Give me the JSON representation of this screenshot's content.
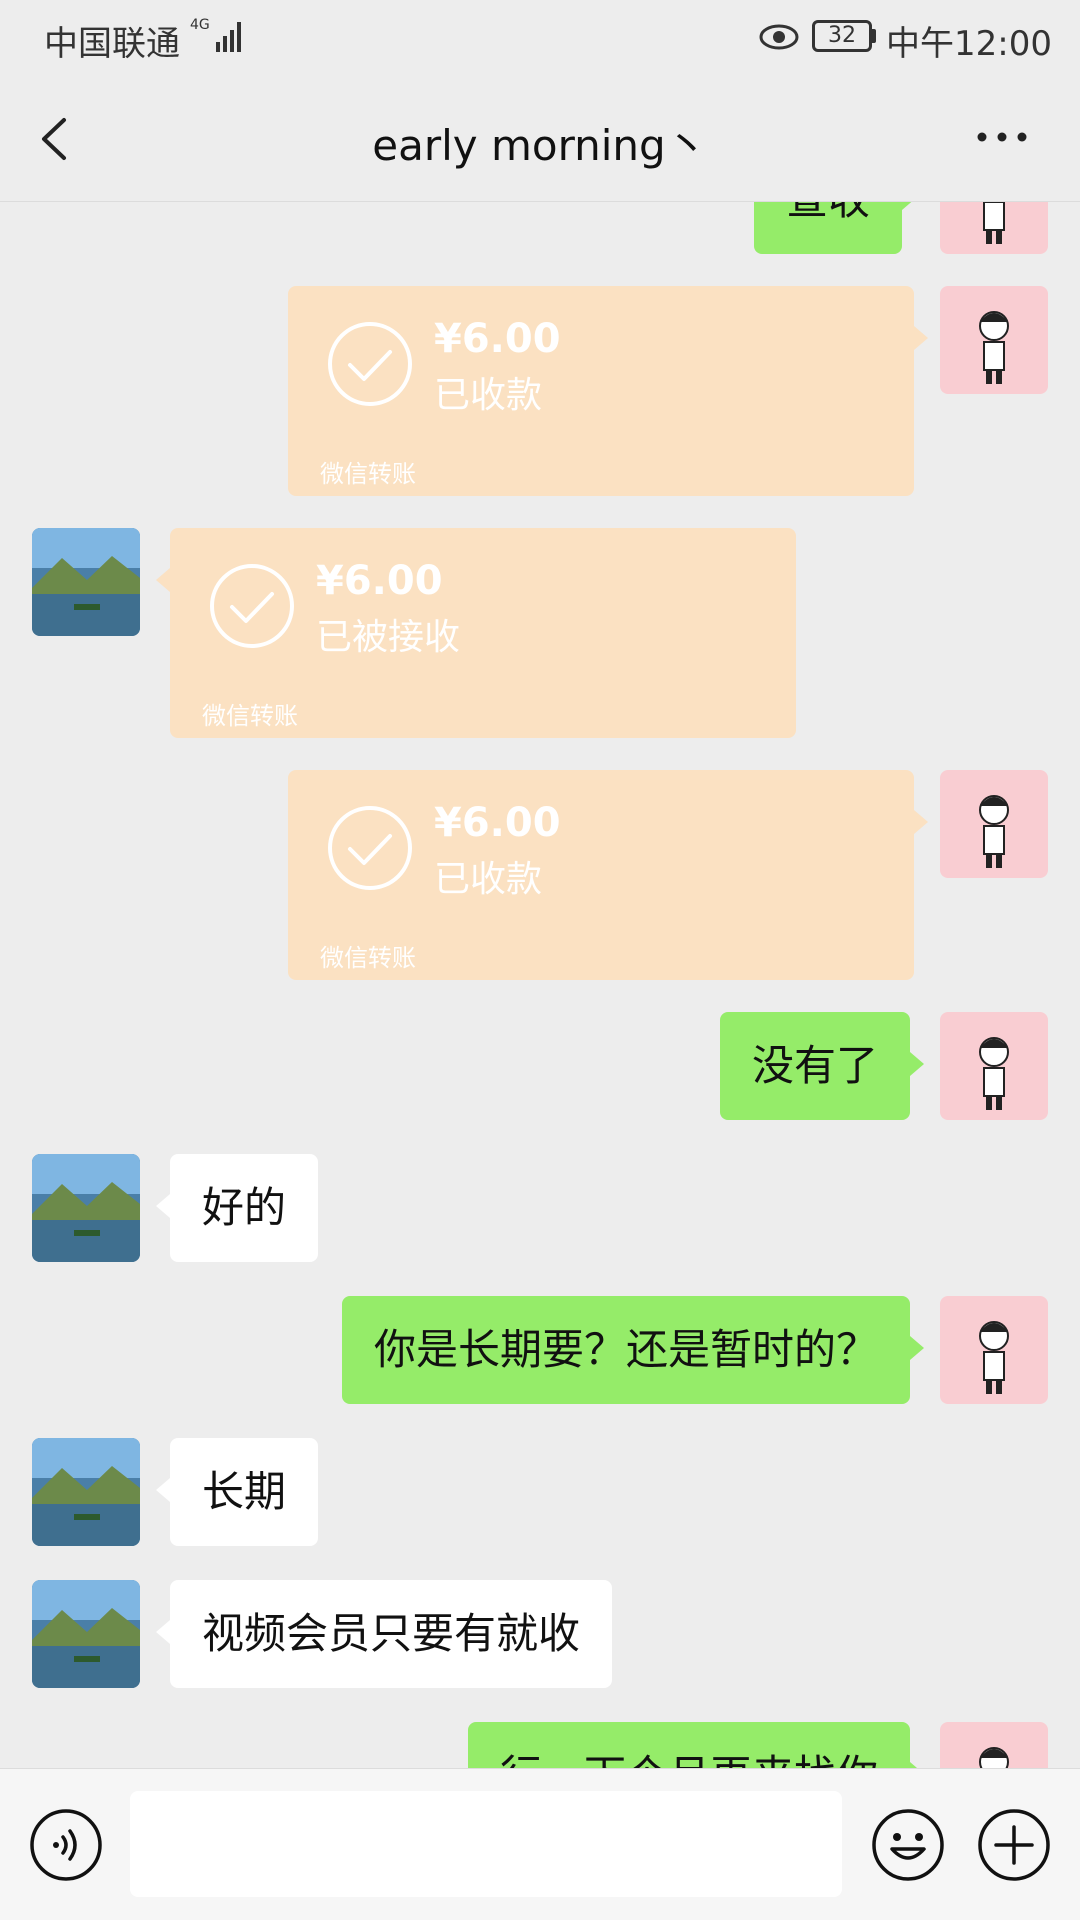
{
  "status_bar": {
    "carrier": "中国联通",
    "network": "4G",
    "battery": "32",
    "time": "中午12:00"
  },
  "header": {
    "title": "early morning丶",
    "back_icon": "chevron-left-icon",
    "more_icon": "more-dots-icon"
  },
  "messages": {
    "m0": {
      "text": "查收"
    },
    "t1": {
      "amount": "¥6.00",
      "status": "已收款",
      "label": "微信转账"
    },
    "t2": {
      "amount": "¥6.00",
      "status": "已被接收",
      "label": "微信转账"
    },
    "t3": {
      "amount": "¥6.00",
      "status": "已收款",
      "label": "微信转账"
    },
    "m4": {
      "text": "没有了"
    },
    "m5": {
      "text": "好的"
    },
    "m6": {
      "text": "你是长期要？还是暂时的？"
    },
    "m7": {
      "text": "长期"
    },
    "m8": {
      "text": "视频会员只要有就收"
    },
    "m9": {
      "text": "行，下个月再来找你"
    }
  },
  "input_bar": {
    "voice_icon": "voice-icon",
    "emoji_icon": "emoji-icon",
    "plus_icon": "plus-icon"
  },
  "colors": {
    "background": "#ededed",
    "my_bubble": "#95ec69",
    "their_bubble": "#ffffff",
    "transfer_bubble": "#fbe1c2"
  }
}
